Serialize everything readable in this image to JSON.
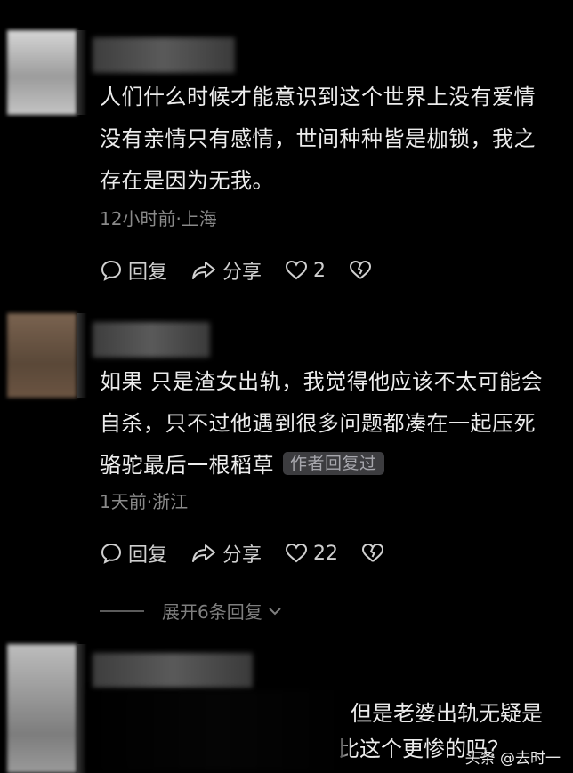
{
  "comments": [
    {
      "text": "人们什么时候才能意识到这个世界上没有爱情没有亲情只有感情，世间种种皆是枷锁，我之存在是因为无我。",
      "meta": "12小时前·上海",
      "reply_label": "回复",
      "share_label": "分享",
      "like_count": "2"
    },
    {
      "text": "如果 只是渣女出轨，我觉得他应该不太可能会自杀，只不过他遇到很多问题都凑在一起压死骆驼最后一根稻草",
      "badge": "作者回复过",
      "meta": "1天前·浙江",
      "reply_label": "回复",
      "share_label": "分享",
      "like_count": "22"
    },
    {
      "text_line1": "但是老婆出轨无疑是",
      "text_line2": "比这个更惨的吗？"
    }
  ],
  "expand_label": "展开6条回复",
  "watermark": "头条 @去时一"
}
